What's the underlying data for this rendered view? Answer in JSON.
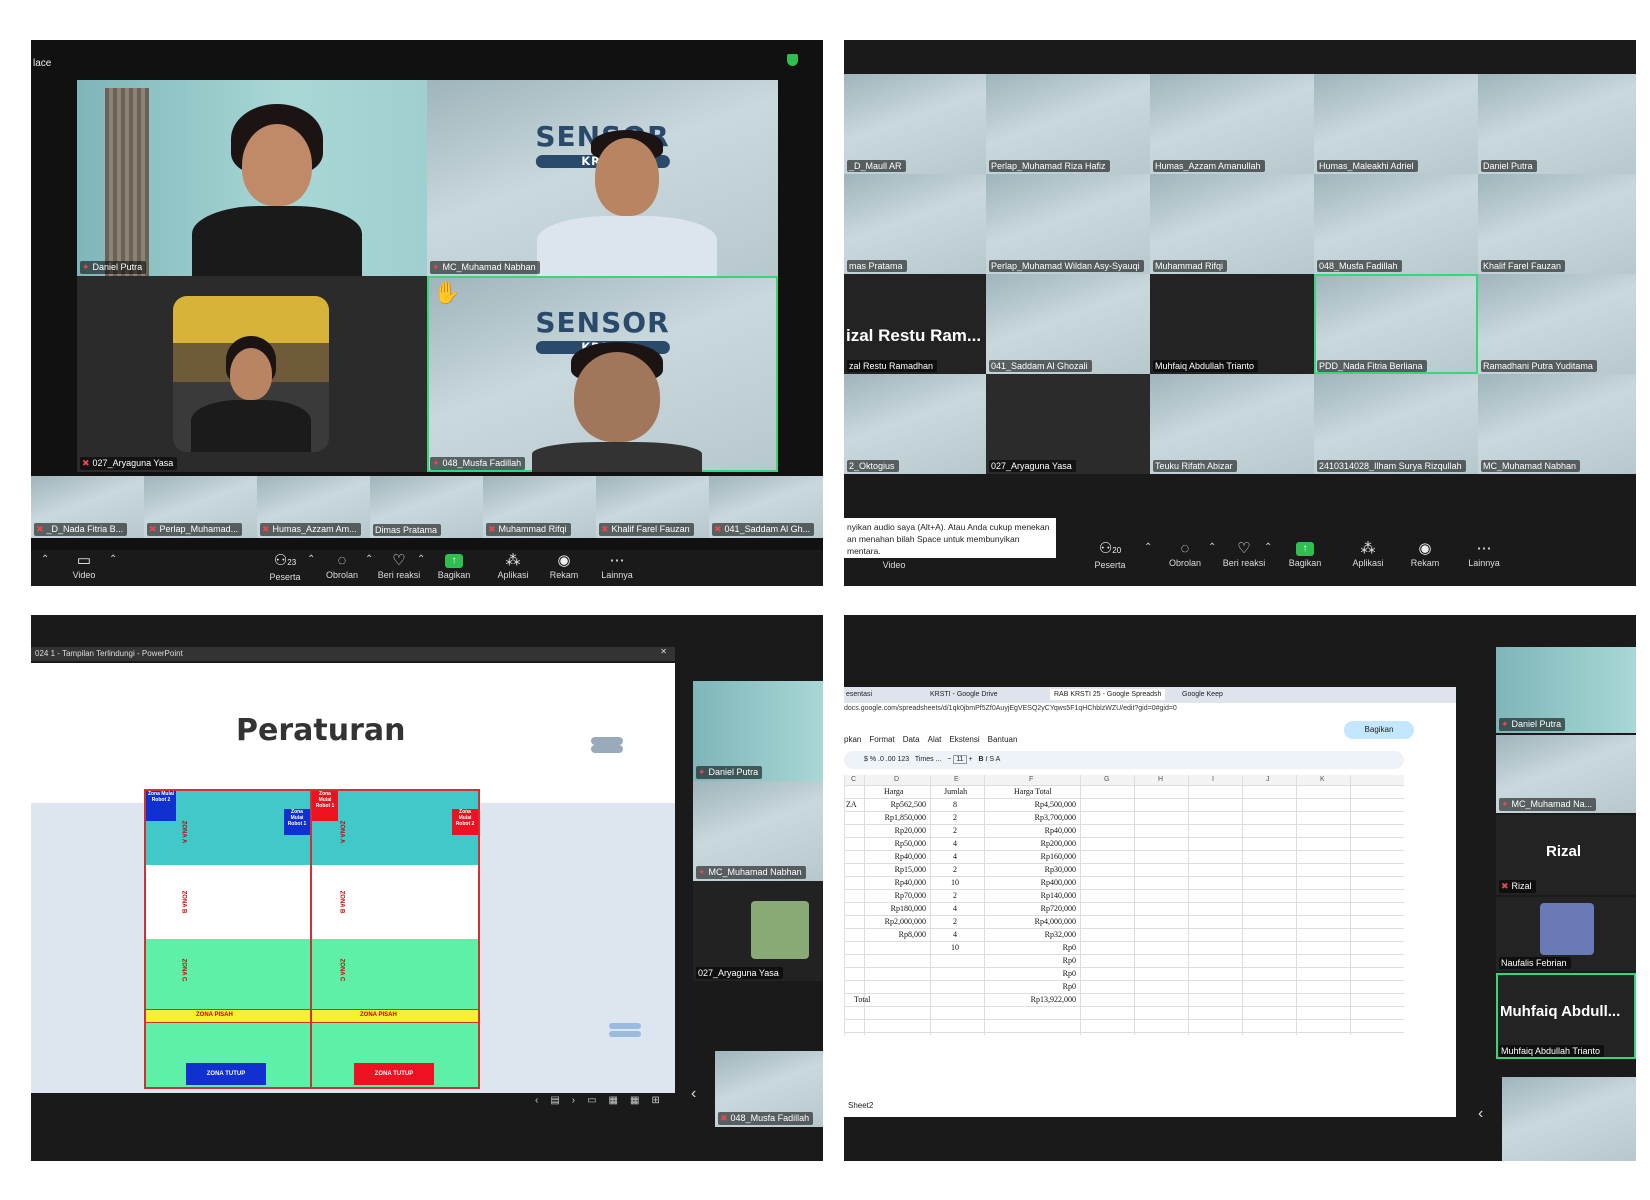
{
  "q1": {
    "title_fragment": "lace",
    "tiles": [
      {
        "name": "Daniel Putra"
      },
      {
        "name": "MC_Muhamad Nabhan"
      },
      {
        "name": "027_Aryaguna Yasa"
      },
      {
        "name": "048_Musfa Fadillah"
      }
    ],
    "strip": [
      "_D_Nada Fitria B...",
      "Perlap_Muhamad...",
      "Humas_Azzam Am...",
      "Dimas Pratama",
      "Muhammad Rifqi",
      "Khalif Farel Fauzan",
      "041_Saddam Al Gh..."
    ],
    "toolbar": {
      "video": "Video",
      "participants": "Peserta",
      "participants_count": "23",
      "chat": "Obrolan",
      "react": "Beri reaksi",
      "share": "Bagikan",
      "apps": "Aplikasi",
      "record": "Rekam",
      "more": "Lainnya"
    },
    "banner": "SENSOR",
    "banner_sub": "KRSTI"
  },
  "q2": {
    "tiles": [
      "_D_Maull AR",
      "Perlap_Muhamad Riza Hafiz",
      "Humas_Azzam Amanullah",
      "Humas_Maleakhi Adriel",
      "Daniel Putra",
      "mas Pratama",
      "Perlap_Muhamad Wildan Asy-Syauqi",
      "Muhammad Rifqi",
      "048_Musfa Fadillah",
      "Khalif Farel Fauzan",
      "zal Restu Ramadhan",
      "041_Saddam Al Ghozali",
      "Muhfaiq Abdullah Trianto",
      "PDD_Nada Fitria Berliana",
      "Ramadhani Putra Yuditama",
      "2_Oktogius",
      "027_Aryaguna Yasa",
      "Teuku Rifath Abizar",
      "2410314028_Ilham Surya Rizqullah",
      "MC_Muhamad Nabhan"
    ],
    "big_name": "izal Restu Ram...",
    "tooltip": "nyikan audio saya (Alt+A). Atau Anda cukup menekan an menahan bilah Space untuk membunyikan mentara.",
    "toolbar": {
      "video": "Video",
      "participants": "Peserta",
      "participants_count": "20",
      "chat": "Obrolan",
      "react": "Beri reaksi",
      "share": "Bagikan",
      "apps": "Aplikasi",
      "record": "Rekam",
      "more": "Lainnya"
    }
  },
  "q3": {
    "window_title": "024 1 - Tampilan Terlindungi - PowerPoint",
    "slide_title": "Peraturan",
    "zones": {
      "start1": "Zona Mulai Robot 2",
      "start2": "Zona Mulai Robot 1",
      "start3": "Zona Mulai Robot 1",
      "start4": "Zona Mulai Robot 2",
      "a": "ZONA A",
      "b": "ZONA B",
      "c": "ZONA C",
      "pisah": "ZONA PISAH",
      "tutup": "ZONA TUTUP"
    },
    "side": [
      "Daniel Putra",
      "MC_Muhamad Nabhan",
      "027_Aryaguna Yasa",
      "048_Musfa Fadillah"
    ]
  },
  "q4": {
    "tabs": [
      "esentasi",
      "KRSTI - Google Drive",
      "RAB KRSTI 25 - Google Spreadsh",
      "Google Keep"
    ],
    "url": "docs.google.com/spreadsheets/d/1qk0jbmPf5Zf0AuyjEgVESQ2yCYqws5F1qHChblzWZU/edit?gid=0#gid=0",
    "menu": [
      "pkan",
      "Format",
      "Data",
      "Alat",
      "Ekstensi",
      "Bantuan"
    ],
    "share": "Bagikan",
    "font": "Times ...",
    "size": "11",
    "cols": [
      "C",
      "D",
      "E",
      "F",
      "G",
      "H",
      "I",
      "J",
      "K"
    ],
    "headers": [
      "Harga",
      "Jumlah",
      "Harga Total"
    ],
    "rows": [
      [
        "ZA",
        "Rp562,500",
        "8",
        "Rp4,500,000"
      ],
      [
        "",
        "Rp1,850,000",
        "2",
        "Rp3,700,000"
      ],
      [
        "",
        "Rp20,000",
        "2",
        "Rp40,000"
      ],
      [
        "",
        "Rp50,000",
        "4",
        "Rp200,000"
      ],
      [
        "",
        "Rp40,000",
        "4",
        "Rp160,000"
      ],
      [
        "",
        "Rp15,000",
        "2",
        "Rp30,000"
      ],
      [
        "",
        "Rp40,000",
        "10",
        "Rp400,000"
      ],
      [
        "",
        "Rp70,000",
        "2",
        "Rp140,000"
      ],
      [
        "",
        "Rp180,000",
        "4",
        "Rp720,000"
      ],
      [
        "",
        "Rp2,000,000",
        "2",
        "Rp4,000,000"
      ],
      [
        "",
        "Rp8,000",
        "4",
        "Rp32,000"
      ],
      [
        "",
        "",
        "10",
        "Rp0"
      ],
      [
        "",
        "",
        "",
        "Rp0"
      ],
      [
        "",
        "",
        "",
        "Rp0"
      ],
      [
        "",
        "",
        "",
        "Rp0"
      ]
    ],
    "total_label": "Total",
    "total": "Rp13,922,000",
    "sheet": "Sheet2",
    "side": [
      "Daniel Putra",
      "MC_Muhamad Na...",
      "Rizal",
      "Naufalis Febrian",
      "Muhfaiq Abdullah Trianto"
    ],
    "side_big": [
      "Rizal",
      "Muhfaiq Abdull..."
    ]
  }
}
